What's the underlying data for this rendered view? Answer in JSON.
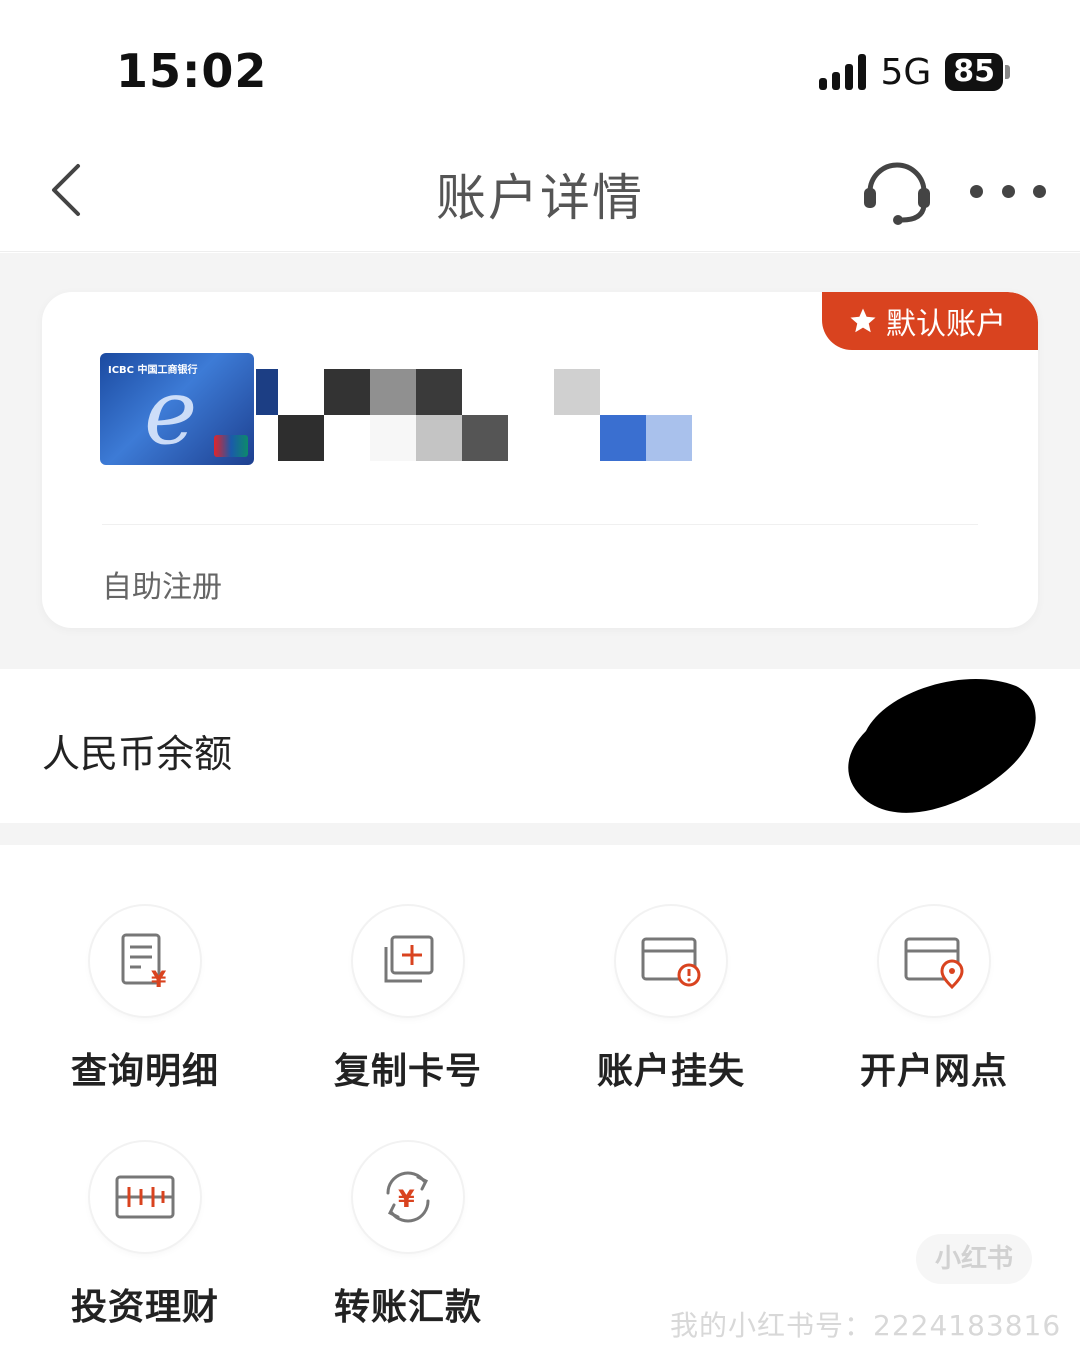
{
  "status_bar": {
    "time": "15:02",
    "network": "5G",
    "battery": "85"
  },
  "nav": {
    "title": "账户详情"
  },
  "account_card": {
    "badge": "默认账户",
    "note": "自助注册",
    "card_brand": "ICBC 中国工商银行"
  },
  "balance": {
    "label": "人民币余额"
  },
  "functions": [
    {
      "label": "查询明细",
      "icon": "statement-icon"
    },
    {
      "label": "复制卡号",
      "icon": "copy-icon"
    },
    {
      "label": "账户挂失",
      "icon": "card-alert-icon"
    },
    {
      "label": "开户网点",
      "icon": "card-location-icon"
    },
    {
      "label": "投资理财",
      "icon": "invest-icon"
    },
    {
      "label": "转账汇款",
      "icon": "transfer-icon"
    }
  ],
  "watermark": {
    "text": "我的小红书号：2224183816",
    "logo": "小红书"
  },
  "colors": {
    "accent": "#d9431f",
    "icon_red": "#d9431f",
    "icon_grey": "#777777"
  }
}
